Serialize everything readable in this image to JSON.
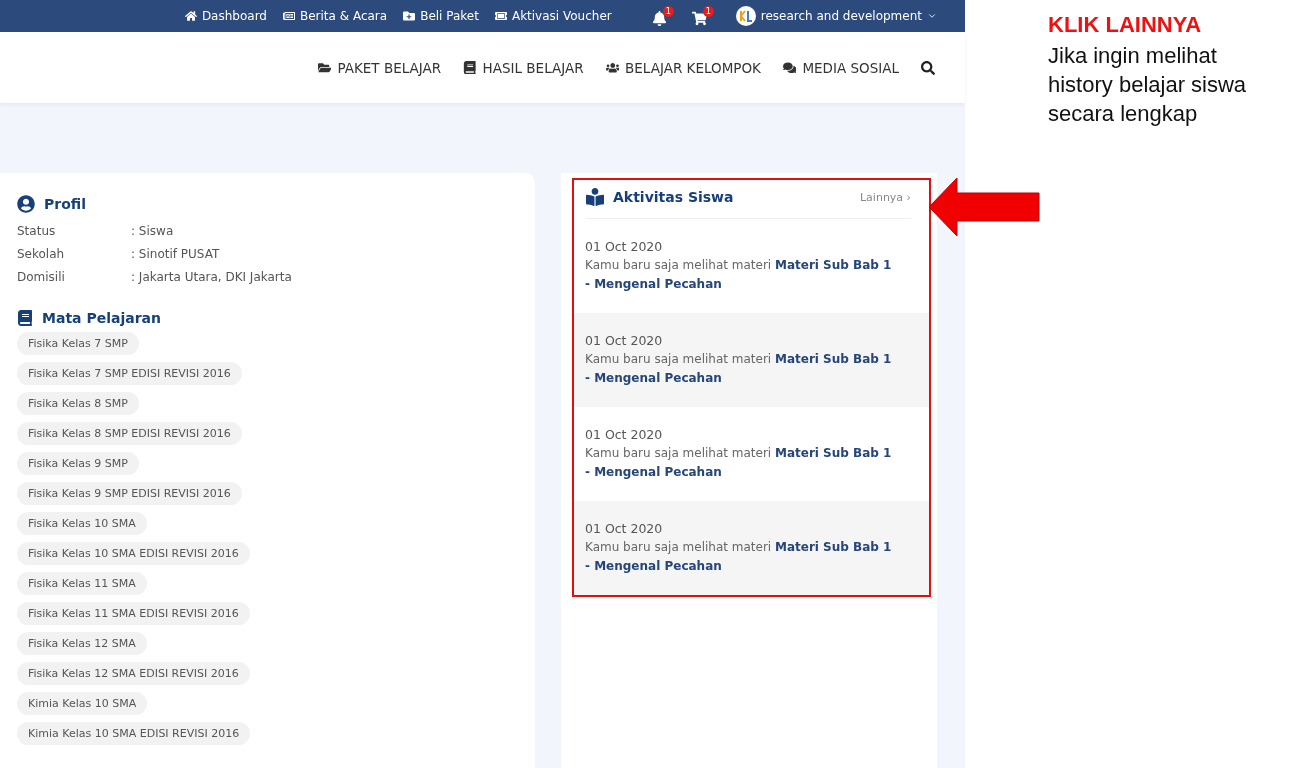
{
  "top_bar": {
    "links": [
      {
        "label": "Dashboard"
      },
      {
        "label": "Berita & Acara"
      },
      {
        "label": "Beli Paket"
      },
      {
        "label": "Aktivasi Voucher"
      }
    ],
    "notifications": {
      "count": "1"
    },
    "cart": {
      "count": "1"
    },
    "user": {
      "name": "research and development"
    }
  },
  "nav": {
    "items": [
      {
        "label": "PAKET BELAJAR"
      },
      {
        "label": "HASIL BELAJAR"
      },
      {
        "label": "BELAJAR KELOMPOK"
      },
      {
        "label": "MEDIA SOSIAL"
      }
    ]
  },
  "profile": {
    "title": "Profil",
    "fields": [
      {
        "label": "Status",
        "value": ": Siswa"
      },
      {
        "label": "Sekolah",
        "value": ": Sinotif PUSAT"
      },
      {
        "label": "Domisili",
        "value": ": Jakarta Utara, DKI Jakarta"
      }
    ]
  },
  "subjects": {
    "title": "Mata Pelajaran",
    "items": [
      "Fisika Kelas 7 SMP",
      "Fisika Kelas 7 SMP EDISI REVISI 2016",
      "Fisika Kelas 8 SMP",
      "Fisika Kelas 8 SMP EDISI REVISI 2016",
      "Fisika Kelas 9 SMP",
      "Fisika Kelas 9 SMP EDISI REVISI 2016",
      "Fisika Kelas 10 SMA",
      "Fisika Kelas 10 SMA EDISI REVISI 2016",
      "Fisika Kelas 11 SMA",
      "Fisika Kelas 11 SMA EDISI REVISI 2016",
      "Fisika Kelas 12 SMA",
      "Fisika Kelas 12 SMA EDISI REVISI 2016",
      "Kimia Kelas 10 SMA",
      "Kimia Kelas 10 SMA EDISI REVISI 2016"
    ]
  },
  "activity": {
    "title": "Aktivitas Siswa",
    "more": "Lainnya ›",
    "items": [
      {
        "date": "01 Oct 2020",
        "text": "Kamu baru saja melihat materi **Materi Sub Bab 1 - Mengenal Pecahan**"
      },
      {
        "date": "01 Oct 2020",
        "text": "Kamu baru saja melihat materi **Materi Sub Bab 1 - Mengenal Pecahan**"
      },
      {
        "date": "01 Oct 2020",
        "text": "Kamu baru saja melihat materi **Materi Sub Bab 1 - Mengenal Pecahan**"
      },
      {
        "date": "01 Oct 2020",
        "text": "Kamu baru saja melihat materi **Materi Sub Bab 1 - Mengenal Pecahan**"
      }
    ]
  },
  "annotation": {
    "title": "KLIK LAINNYA",
    "text": "Jika ingin melihat history belajar siswa secara lengkap"
  }
}
